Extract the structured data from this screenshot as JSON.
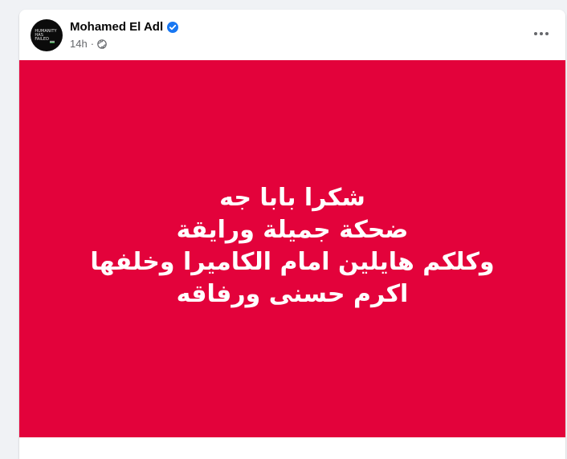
{
  "post": {
    "author": "Mohamed El Adl",
    "verified": true,
    "timestamp": "14h",
    "visibility_icon": "globe-icon",
    "more_icon": "more-options-icon",
    "avatar_text": "HUMANITY\nHAS\nFAILED",
    "background_color": "#e3023b",
    "text_lines": [
      "شكرا بابا جه",
      "ضحكة جميلة ورايقة",
      "وكلكم هايلين امام الكاميرا وخلفها",
      "اكرم حسنى ورفاقه"
    ]
  }
}
